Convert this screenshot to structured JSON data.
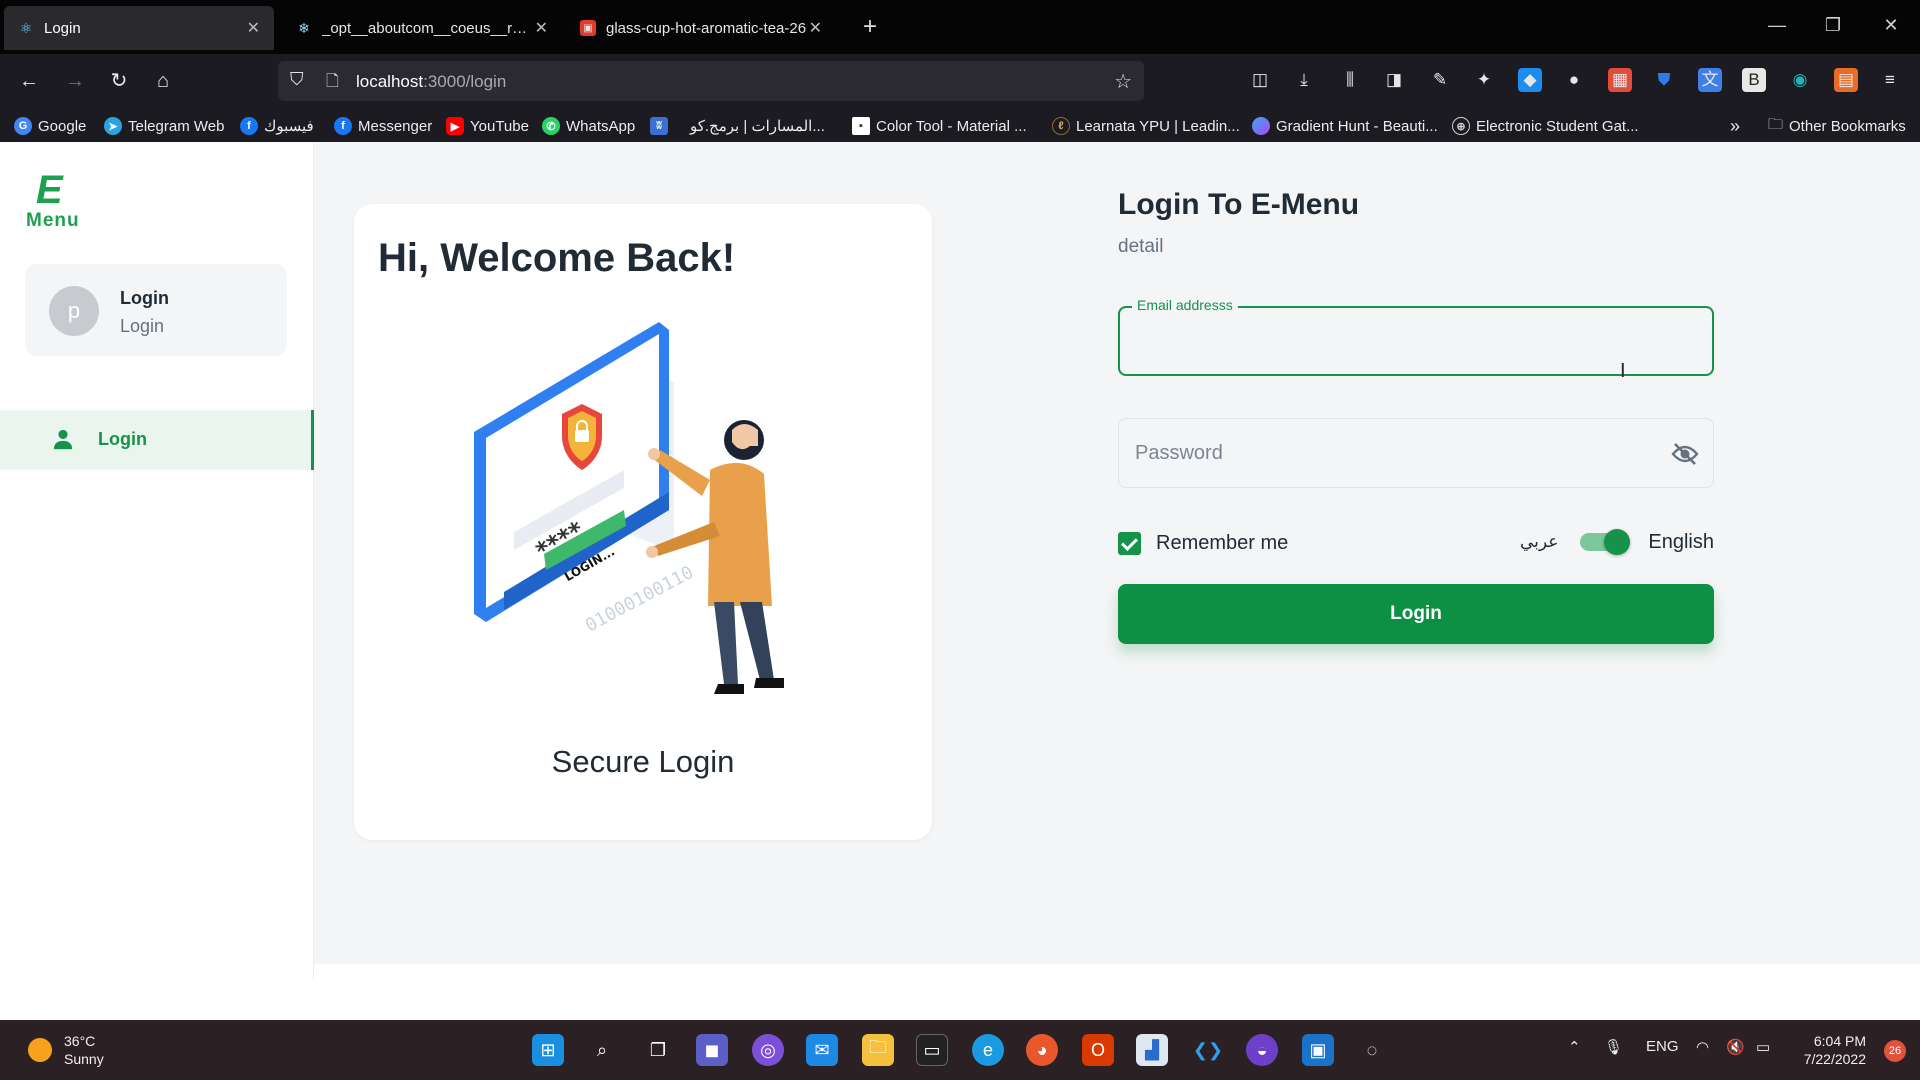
{
  "browser": {
    "tabs": [
      {
        "label": "Login",
        "icon": "react-icon"
      },
      {
        "label": "_opt__aboutcom__coeus__reso",
        "icon": "snowflake-icon"
      },
      {
        "label": "glass-cup-hot-aromatic-tea-26",
        "icon": "image-file-icon"
      }
    ],
    "url_host": "localhost",
    "url_path": ":3000/login",
    "bookmarks": [
      {
        "label": "Google",
        "icon": "google-icon",
        "color": "#4285f4"
      },
      {
        "label": "Telegram Web",
        "icon": "telegram-icon",
        "color": "#2aa3df"
      },
      {
        "label": "فيسبوك",
        "icon": "facebook-icon",
        "color": "#1877f2"
      },
      {
        "label": "Messenger",
        "icon": "facebook-icon",
        "color": "#1877f2"
      },
      {
        "label": "YouTube",
        "icon": "youtube-icon",
        "color": "#ff0000"
      },
      {
        "label": "WhatsApp",
        "icon": "whatsapp-icon",
        "color": "#25d366"
      },
      {
        "label": "",
        "icon": "bookmark-app-icon",
        "color": "#3b6fd4"
      },
      {
        "label": "المسارات | برمج.كو...",
        "icon": "none",
        "color": ""
      },
      {
        "label": "Color Tool - Material ...",
        "icon": "page-icon",
        "color": "#ffffff"
      },
      {
        "label": "Learnata YPU | Leadin...",
        "icon": "learnata-icon",
        "color": "#8a6b2e"
      },
      {
        "label": "Gradient Hunt - Beauti...",
        "icon": "gradient-icon",
        "color": "#7a63f0"
      },
      {
        "label": "Electronic Student Gat...",
        "icon": "globe-icon",
        "color": "#cccccc"
      }
    ],
    "other_bookmarks": "Other Bookmarks"
  },
  "app": {
    "logo_letter": "E",
    "logo_word": "Menu",
    "user": {
      "avatar_letter": "p",
      "name": "Login",
      "role": "Login"
    },
    "nav": [
      {
        "label": "Login",
        "icon": "person-icon"
      }
    ],
    "hero": {
      "title": "Hi, Welcome Back!",
      "caption": "Secure Login",
      "illustration_text": "LOGIN..."
    },
    "form": {
      "title": "Login To E-Menu",
      "subtitle": "detail",
      "email_label": "Email addresss",
      "email_value": "",
      "password_placeholder": "Password",
      "remember_label": "Remember me",
      "remember_checked": true,
      "lang_arabic": "عربي",
      "lang_english": "English",
      "lang_english_selected": true,
      "submit_label": "Login"
    },
    "accent_color": "#16924a"
  },
  "taskbar": {
    "temperature": "36°C",
    "weather": "Sunny",
    "language": "ENG",
    "time": "6:04 PM",
    "date": "7/22/2022",
    "notifications": "26"
  }
}
